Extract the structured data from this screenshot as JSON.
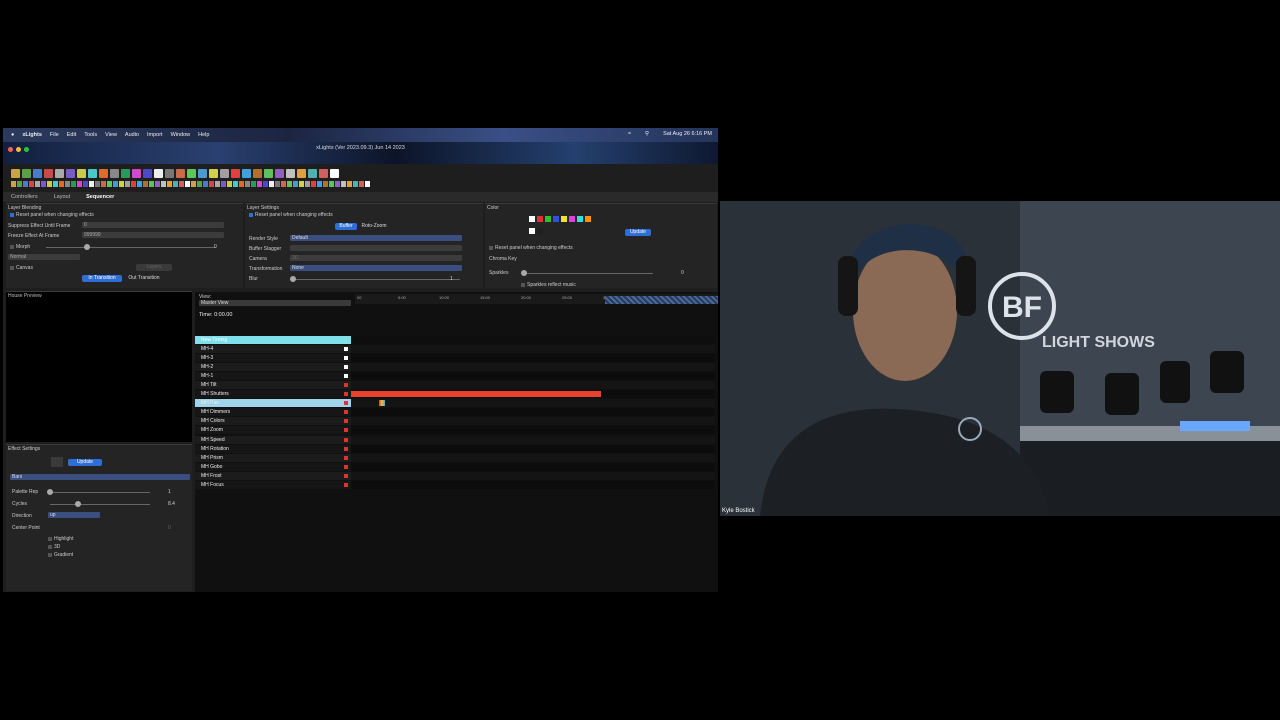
{
  "menubar": {
    "app": "xLights",
    "items": [
      "File",
      "Edit",
      "Tools",
      "View",
      "Audio",
      "Import",
      "Window",
      "Help"
    ],
    "datetime": "Sat Aug 26  6:16 PM"
  },
  "window": {
    "title": "xLights (Ver 2023.09.3) Jun 14 2023"
  },
  "tabs": [
    "Controllers",
    "Layout",
    "Sequencer"
  ],
  "layer_blending": {
    "title": "Layer Blending",
    "reset_label": "Reset panel when changing effects",
    "suppress_label": "Suppress Effect Until Frame",
    "suppress_value": "0",
    "freeze_label": "Freeze Effect At Frame",
    "freeze_value": "999999",
    "morph_label": "Morph",
    "morph_value": "0",
    "normal_label": "Normal",
    "canvas_label": "Canvas",
    "layers_btn": "Layers",
    "in_transition": "In Transition",
    "out_transition": "Out Transition"
  },
  "layer_settings": {
    "title": "Layer Settings",
    "reset_label": "Reset panel when changing effects",
    "buffer_tab": "Buffer",
    "roto_tab": "Roto-Zoom",
    "render_style_label": "Render Style",
    "render_style_value": "Default",
    "buffer_stagger_label": "Buffer Stagger",
    "camera_label": "Camera",
    "camera_value": "3D",
    "transformation_label": "Transformation",
    "transformation_value": "None",
    "blur_label": "Blur",
    "blur_value": "1"
  },
  "color_panel": {
    "title": "Color",
    "update_btn": "Update",
    "reset_label": "Reset panel when changing effects",
    "chroma_label": "Chroma Key",
    "sparkles_label": "Sparkles",
    "sparkles_value": "0",
    "sparkles_music_label": "Sparkles reflect music",
    "swatches": [
      "#ffffff",
      "#e03030",
      "#30c030",
      "#3050e0",
      "#f0e030",
      "#e040e0",
      "#30e0e0",
      "#ff9000",
      "#ffffff",
      "#202020"
    ]
  },
  "house_preview": {
    "title": "House Preview"
  },
  "effect_settings": {
    "title": "Effect Settings",
    "update_btn": "Update",
    "effect_value": "Bars",
    "palette_rep_label": "Palette Rep",
    "palette_rep_value": "1",
    "cycles_label": "Cycles",
    "cycles_value": "8.4",
    "direction_label": "Direction",
    "direction_value": "up",
    "center_point_label": "Center Point",
    "center_point_value": "0",
    "highlight_label": "Highlight",
    "3d_label": "3D",
    "gradient_label": "Gradient"
  },
  "sequencer": {
    "view_label": "View:",
    "view_value": "Master View",
    "time_label": "Time: 0:00.00",
    "ruler_ticks": [
      "00",
      "5:00",
      "10:00",
      "15:00",
      "20:00",
      "25:00",
      "30:00"
    ],
    "timing_row": "New Timing",
    "models": [
      {
        "name": "MH-4",
        "marker": "white"
      },
      {
        "name": "MH-3",
        "marker": "white"
      },
      {
        "name": "MH-2",
        "marker": "white"
      },
      {
        "name": "MH-1",
        "marker": "white"
      },
      {
        "name": "MH Tilt",
        "marker": "red"
      },
      {
        "name": "MH Shutters",
        "marker": "red"
      },
      {
        "name": "MH Pan",
        "marker": "red"
      },
      {
        "name": "MH Dimmers",
        "marker": "red"
      },
      {
        "name": "MH Colors",
        "marker": "red"
      },
      {
        "name": "MH Zoom",
        "marker": "red"
      },
      {
        "name": "MH Speed",
        "marker": "red"
      },
      {
        "name": "MH Rotation",
        "marker": "red"
      },
      {
        "name": "MH Prism",
        "marker": "red"
      },
      {
        "name": "MH Gobo",
        "marker": "red"
      },
      {
        "name": "MH Frost",
        "marker": "red"
      },
      {
        "name": "MH Focus",
        "marker": "red"
      }
    ],
    "effect_bar_color": "#e8402c"
  },
  "video": {
    "participant_name": "Kyle Bostick",
    "wall_logo": "BF",
    "wall_text": "LIGHT SHOWS"
  }
}
